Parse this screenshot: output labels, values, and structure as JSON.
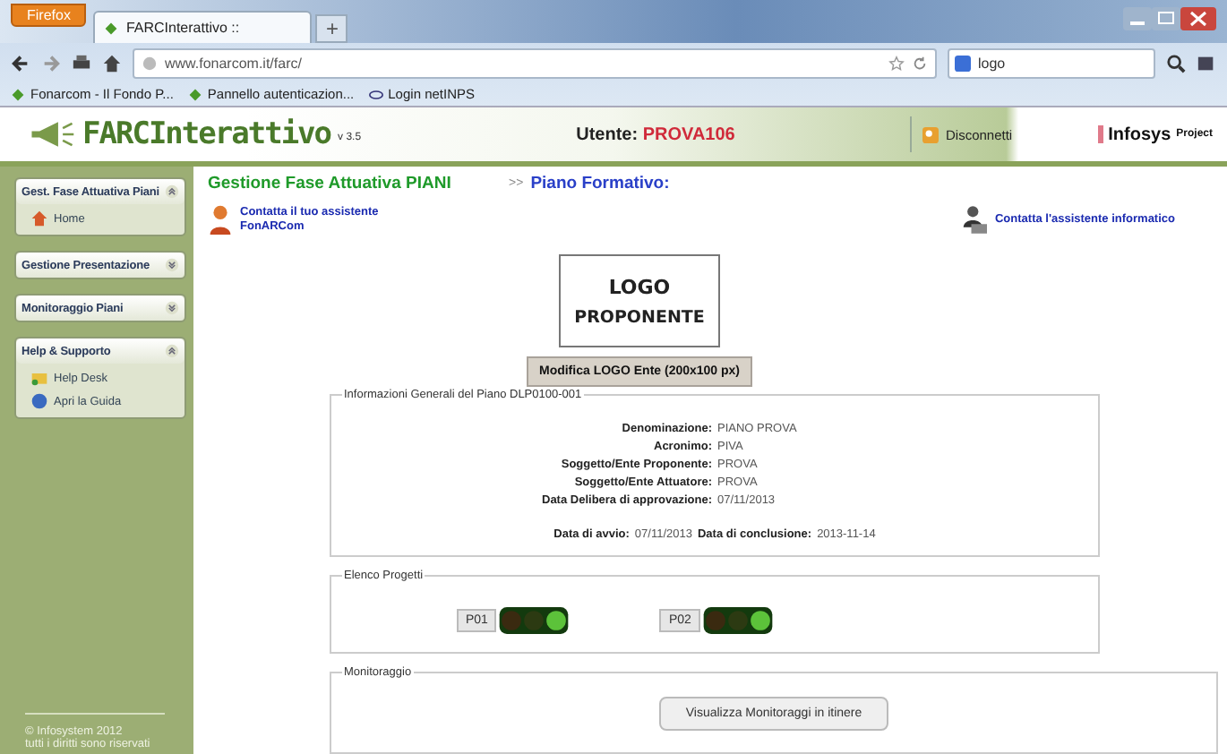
{
  "browser": {
    "menu_button": "Firefox",
    "tabs": [
      {
        "title": "FARCInterattivo ::",
        "selected": true
      }
    ],
    "new_tab": "+",
    "url": "www.fonarcom.it/farc/",
    "search_value": "logo",
    "bookmarks": [
      "Fonarcom - Il Fondo P...",
      "Pannello autenticazion...",
      "Login netINPS"
    ]
  },
  "header": {
    "logo": "FARCInterattivo",
    "version": "v 3.5",
    "user_label": "Utente:",
    "user": "PROVA106",
    "logout": "Disconnetti",
    "brand": "Infosys",
    "brand_suffix": "Project"
  },
  "sidebar": {
    "sections": [
      {
        "title": "Gest. Fase Attuativa Piani",
        "expanded": true,
        "items": [
          {
            "label": "Home",
            "kind": "home"
          }
        ]
      },
      {
        "title": "Gestione Presentazione",
        "expanded": false
      },
      {
        "title": "Monitoraggio Piani",
        "expanded": false
      },
      {
        "title": "Help & Supporto",
        "expanded": true,
        "items": [
          {
            "label": "Help Desk",
            "kind": "helpdesk"
          },
          {
            "label": "Apri la Guida",
            "kind": "guide"
          }
        ]
      }
    ],
    "footer": [
      "© Infosystem 2012",
      "tutti i diritti sono riservati"
    ]
  },
  "page": {
    "title": "Gestione Fase Attuativa PIANI",
    "breadcrumb_sep": ">>",
    "subtitle": "Piano Formativo:",
    "contact_left": [
      "Contatta il tuo assistente",
      "FonARCom"
    ],
    "contact_right": "Contatta l'assistente informatico",
    "logo_lines": [
      "LOGO",
      "PROPONENTE"
    ],
    "logo_button": "Modifica LOGO Ente (200x100 px)",
    "info": {
      "legend": "Informazioni Generali del Piano DLP0100-001",
      "fields": [
        {
          "label": "Denominazione:",
          "value": "PIANO PROVA"
        },
        {
          "label": "Acronimo:",
          "value": "PIVA"
        },
        {
          "label": "Soggetto/Ente Proponente:",
          "value": "PROVA"
        },
        {
          "label": "Soggetto/Ente Attuatore:",
          "value": "PROVA"
        },
        {
          "label": "Data Delibera di approvazione:",
          "value": "07/11/2013"
        }
      ],
      "dates": [
        {
          "label": "Data di avvio:",
          "value": "07/11/2013"
        },
        {
          "label": "Data di conclusione:",
          "value": "2013-11-14"
        }
      ]
    },
    "projects": {
      "legend": "Elenco Progetti",
      "items": [
        {
          "label": "P01",
          "lights": [
            {
              "lit": false
            },
            {
              "lit": false
            },
            {
              "lit": true
            }
          ]
        },
        {
          "label": "P02",
          "lights": [
            {
              "lit": false
            },
            {
              "lit": false
            },
            {
              "lit": true
            }
          ]
        }
      ]
    },
    "monitoring": {
      "legend": "Monitoraggio",
      "button": "Visualizza Monitoraggi in itinere"
    }
  }
}
